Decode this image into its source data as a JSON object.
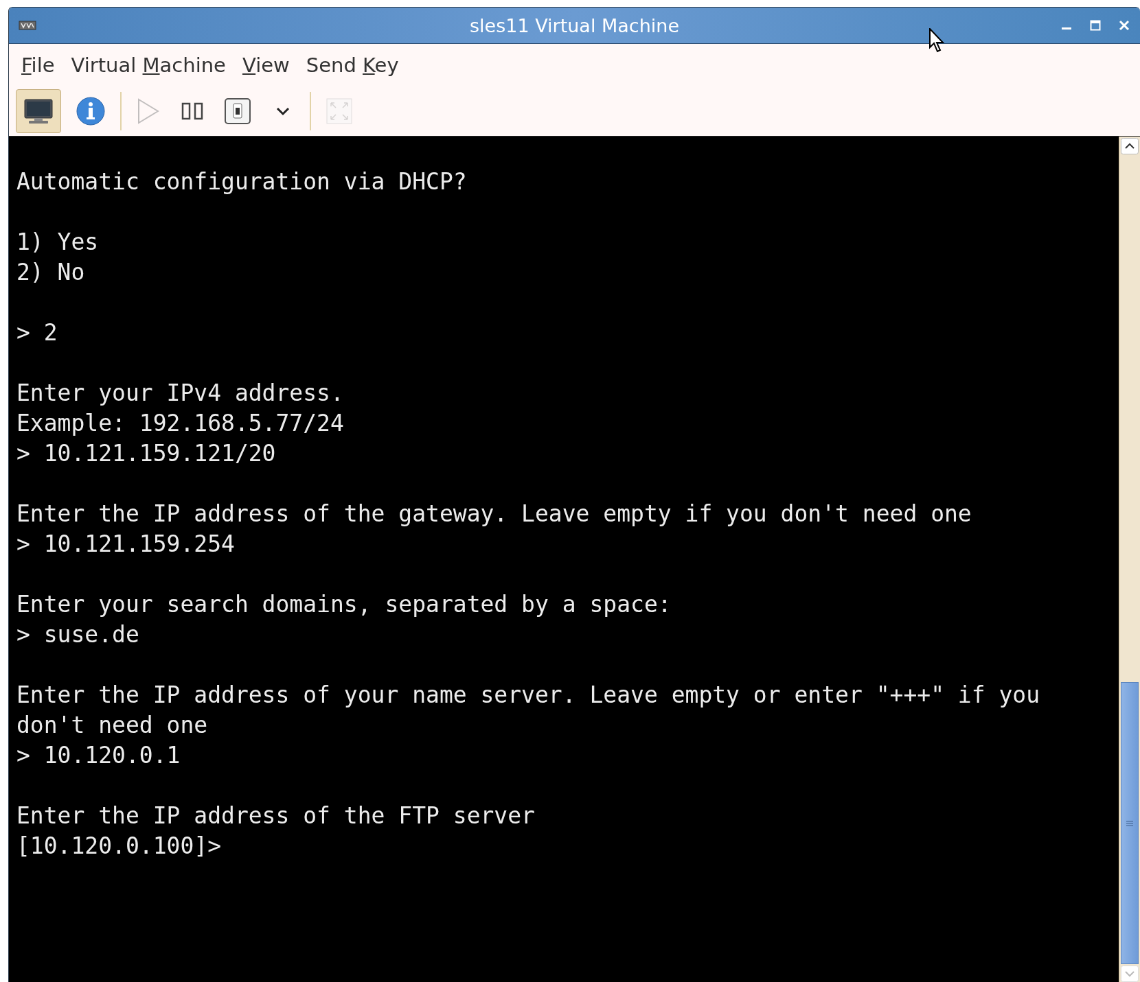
{
  "window": {
    "title": "sles11 Virtual Machine"
  },
  "menu": [
    {
      "parts": [
        {
          "text": "F",
          "underlined": true
        },
        {
          "text": "ile",
          "underlined": false
        }
      ]
    },
    {
      "parts": [
        {
          "text": "Virtual ",
          "underlined": false
        },
        {
          "text": "M",
          "underlined": true
        },
        {
          "text": "achine",
          "underlined": false
        }
      ]
    },
    {
      "parts": [
        {
          "text": "V",
          "underlined": true
        },
        {
          "text": "iew",
          "underlined": false
        }
      ]
    },
    {
      "parts": [
        {
          "text": "Send ",
          "underlined": false
        },
        {
          "text": "K",
          "underlined": true
        },
        {
          "text": "ey",
          "underlined": false
        }
      ]
    }
  ],
  "toolbar": [
    {
      "kind": "console",
      "selected": true,
      "disabled": false
    },
    {
      "kind": "details",
      "selected": false,
      "disabled": false
    },
    {
      "kind": "separator"
    },
    {
      "kind": "run",
      "selected": false,
      "disabled": true
    },
    {
      "kind": "pause",
      "selected": false,
      "disabled": false
    },
    {
      "kind": "shutdown",
      "selected": false,
      "disabled": false
    },
    {
      "kind": "menu",
      "selected": false,
      "disabled": false
    },
    {
      "kind": "separator"
    },
    {
      "kind": "fullscreen",
      "selected": false,
      "disabled": true
    }
  ],
  "console": {
    "blocks": [
      [
        "Automatic configuration via DHCP?"
      ],
      [
        "1) Yes",
        "2) No"
      ],
      [
        "> 2"
      ],
      [
        "Enter your IPv4 address.",
        "Example: 192.168.5.77/24",
        "> 10.121.159.121/20"
      ],
      [
        "Enter the IP address of the gateway. Leave empty if you don't need one",
        "> 10.121.159.254"
      ],
      [
        "Enter your search domains, separated by a space:",
        "> suse.de"
      ],
      [
        "Enter the IP address of your name server. Leave empty or enter \"+++\" if you",
        "don't need one",
        "> 10.120.0.1"
      ],
      [
        "Enter the IP address of the FTP server",
        "[10.120.0.100]>"
      ]
    ]
  }
}
